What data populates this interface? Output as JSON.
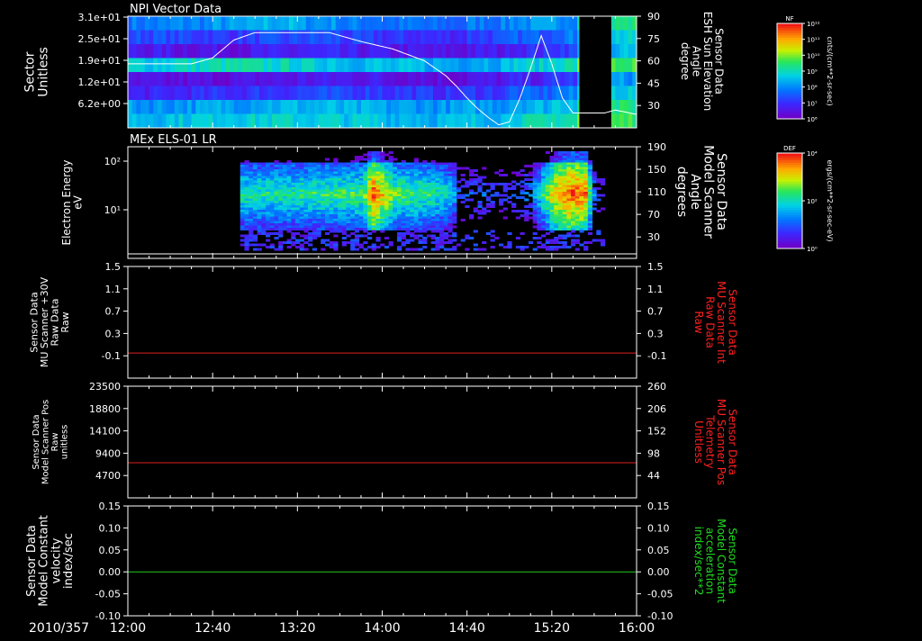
{
  "figure": {
    "date_label": "2010/357",
    "time_ticks": [
      "12:00",
      "12:40",
      "13:20",
      "14:00",
      "14:40",
      "15:20",
      "16:00"
    ]
  },
  "colorbars": [
    {
      "title": "NF",
      "unit": "cnts/(cm**2-sr-sec)",
      "ticks": [
        "10¹²",
        "10¹¹",
        "10¹⁰",
        "10⁹",
        "10⁸",
        "10⁷",
        "10⁶"
      ]
    },
    {
      "title": "DEF",
      "unit": "ergs/(cm**2-sr-sec-eV)",
      "ticks": [
        "10⁴",
        "10²",
        "10⁰"
      ]
    }
  ],
  "chart_data": [
    {
      "type": "heatmap",
      "title": "NPI Vector Data",
      "ylabel": "Sector\nUnitless",
      "y_ticks": [
        "3.1e+01",
        "2.5e+01",
        "1.9e+01",
        "1.2e+01",
        "6.2e+00"
      ],
      "colorbar": "NF",
      "x_range": [
        "12:00",
        "16:00"
      ],
      "rows": 8,
      "band_intensities": [
        [
          0.3,
          0.32,
          0.35,
          0.4,
          0.35,
          0.3,
          0.28,
          0.26,
          0.3,
          0.34,
          0.36,
          0.55
        ],
        [
          0.22,
          0.2,
          0.18,
          0.2,
          0.22,
          0.18,
          0.16,
          0.15,
          0.2,
          0.25,
          0.3,
          0.45
        ],
        [
          0.1,
          0.08,
          0.08,
          0.1,
          0.12,
          0.1,
          0.08,
          0.07,
          0.1,
          0.15,
          0.2,
          0.4
        ],
        [
          0.45,
          0.48,
          0.5,
          0.48,
          0.45,
          0.42,
          0.4,
          0.38,
          0.4,
          0.45,
          0.5,
          0.6
        ],
        [
          0.05,
          0.05,
          0.06,
          0.08,
          0.1,
          0.1,
          0.08,
          0.06,
          0.08,
          0.12,
          0.18,
          0.35
        ],
        [
          0.12,
          0.14,
          0.16,
          0.18,
          0.2,
          0.2,
          0.18,
          0.16,
          0.18,
          0.25,
          0.3,
          0.45
        ],
        [
          0.35,
          0.36,
          0.38,
          0.4,
          0.4,
          0.38,
          0.36,
          0.35,
          0.36,
          0.4,
          0.45,
          0.55
        ],
        [
          0.42,
          0.44,
          0.46,
          0.46,
          0.45,
          0.44,
          0.42,
          0.4,
          0.42,
          0.48,
          0.52,
          0.6
        ]
      ],
      "gap_minutes": [
        [
          "15:33",
          "15:48"
        ]
      ],
      "overlay": {
        "name": "ESH Sun Elevation Angle",
        "right_label": "Sensor Data\nESH Sun Elevation\nAngle\ndegree",
        "right_ticks": [
          "90",
          "75",
          "60",
          "45",
          "30"
        ],
        "right_range": [
          15,
          90
        ],
        "x_minutes": [
          0,
          20,
          30,
          40,
          50,
          60,
          75,
          85,
          95,
          110,
          125,
          140,
          150,
          155,
          160,
          165,
          170,
          175,
          180,
          185,
          190,
          195,
          200,
          205,
          210,
          215,
          220,
          225,
          230,
          240
        ],
        "y": [
          58,
          58,
          58,
          62,
          74,
          79,
          79,
          79,
          79,
          73,
          68,
          60,
          50,
          43,
          35,
          28,
          22,
          17,
          19,
          35,
          55,
          77,
          58,
          35,
          25,
          25,
          25,
          25,
          27,
          24
        ]
      }
    },
    {
      "type": "heatmap",
      "title": "MEx ELS-01 LR",
      "ylabel": "Electron Energy\neV",
      "y_ticks": [
        "10²",
        "10¹"
      ],
      "colorbar": "DEF",
      "x_range": [
        "12:00",
        "16:00"
      ],
      "data_start": "12:53",
      "activity_profile": {
        "x_minutes": [
          53,
          70,
          90,
          110,
          115,
          125,
          140,
          150,
          156,
          165,
          170,
          180,
          190,
          200,
          208,
          215,
          220
        ],
        "peak": [
          0.55,
          0.55,
          0.58,
          0.6,
          0.95,
          0.62,
          0.58,
          0.5,
          0.25,
          0.3,
          0.2,
          0.2,
          0.35,
          0.8,
          0.95,
          0.9,
          0.2
        ]
      },
      "overlay": {
        "name": "Model Scanner Angle",
        "right_label": "Sensor Data\nModel Scanner\nAngle\ndegrees",
        "right_ticks": [
          "190",
          "150",
          "110",
          "70",
          "30"
        ],
        "right_range": [
          -8,
          190
        ],
        "y_constant": 0
      }
    },
    {
      "type": "line",
      "ylabel": "Sensor Data\nMU Scanner +30V\nRaw Data\nRaw",
      "y_ticks": [
        "1.5",
        "1.1",
        "0.7",
        "0.3",
        "-0.1"
      ],
      "ylim": [
        -0.5,
        1.5
      ],
      "series": [
        {
          "name": "MU Scanner +30V Raw Data",
          "values": [
            -0.05,
            -0.05
          ],
          "color": "#e02020"
        }
      ],
      "right_label": "Sensor Data\nMU Scanner Int\nRaw Data\nRaw",
      "right_ticks": [
        "1.5",
        "1.1",
        "0.7",
        "0.3",
        "-0.1"
      ],
      "right_label_color": "#ff2020"
    },
    {
      "type": "line",
      "ylabel": "Sensor Data\nModel Scanner Pos\nRaw\nunitless",
      "y_ticks": [
        "23500",
        "18800",
        "14100",
        "9400",
        "4700"
      ],
      "ylim": [
        0,
        23500
      ],
      "series": [
        {
          "name": "Model Scanner Pos Raw",
          "values": [
            7400,
            7400
          ],
          "color": "#e02020"
        }
      ],
      "right_label": "Sensor Data\nMU Scanner Pos\nTelemetry\nUnitless",
      "right_ticks": [
        "260",
        "206",
        "152",
        "98",
        "44"
      ],
      "right_label_color": "#ff2020"
    },
    {
      "type": "line",
      "ylabel": "Sensor Data\nModel Constant\nvelocity\nindex/sec",
      "y_ticks": [
        "0.15",
        "0.10",
        "0.05",
        "0.00",
        "-0.05",
        "-0.10"
      ],
      "ylim": [
        -0.1,
        0.15
      ],
      "series": [
        {
          "name": "Model Constant velocity",
          "values": [
            0,
            0
          ],
          "color": "#22cc22"
        }
      ],
      "right_label": "Sensor Data\nModel Constant\nacceleration\nindex/sec**2",
      "right_ticks": [
        "0.15",
        "0.10",
        "0.05",
        "0.00",
        "-0.05",
        "-0.10"
      ],
      "right_label_color": "#22dd22"
    }
  ]
}
